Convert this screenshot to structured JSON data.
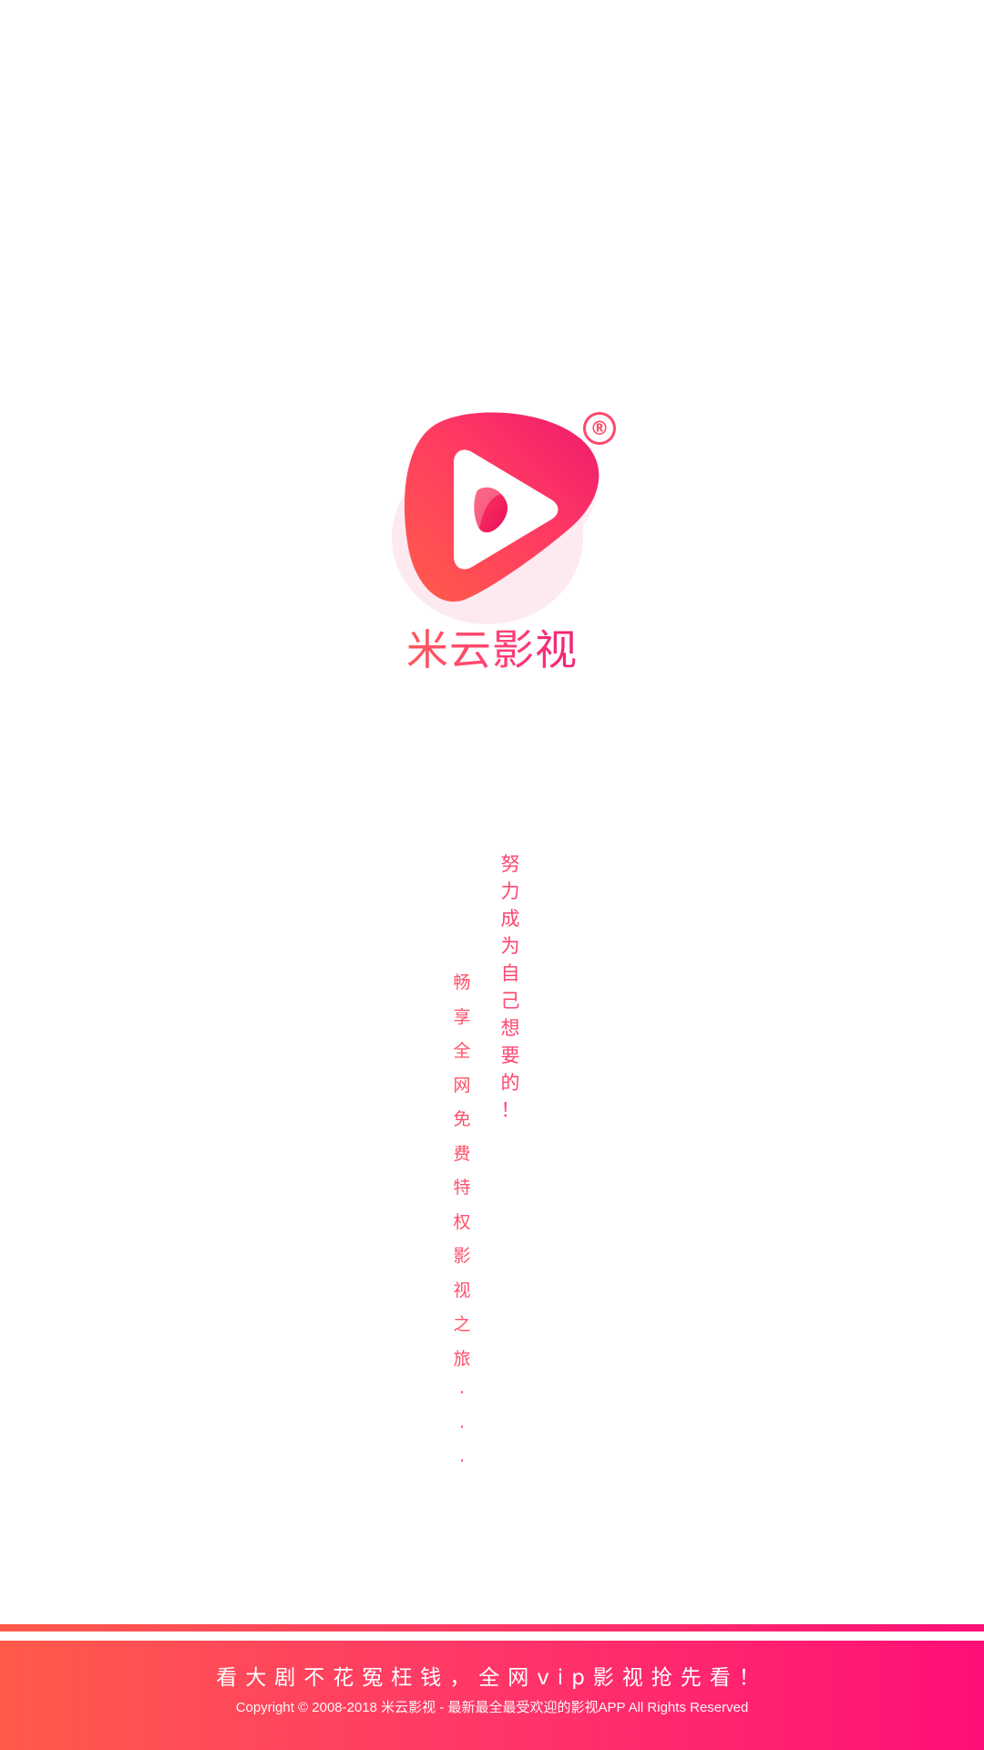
{
  "app": {
    "name": "米云影视",
    "registered_mark": "®",
    "logo_icon": "play-triangle-icon"
  },
  "slogans": {
    "right_vertical": [
      "努",
      "力",
      "成",
      "为",
      "自",
      "己",
      "想",
      "要",
      "的",
      "！"
    ],
    "left_vertical": [
      "畅",
      "享",
      "全",
      "网",
      "免",
      "费",
      "特",
      "权",
      "影",
      "视",
      "之",
      "旅",
      "·",
      "·",
      "·"
    ]
  },
  "footer": {
    "slogan": "看大剧不花冤枉钱，全网vip影视抢先看！",
    "copyright": "Copyright © 2008-2018 米云影视 - 最新最全最受欢迎的影视APP All Rights Reserved"
  },
  "colors": {
    "brand_start": "#ff5a4a",
    "brand_mid": "#ff3a66",
    "brand_end": "#ff0f78",
    "text_accent": "#ff4570",
    "background": "#ffffff"
  }
}
